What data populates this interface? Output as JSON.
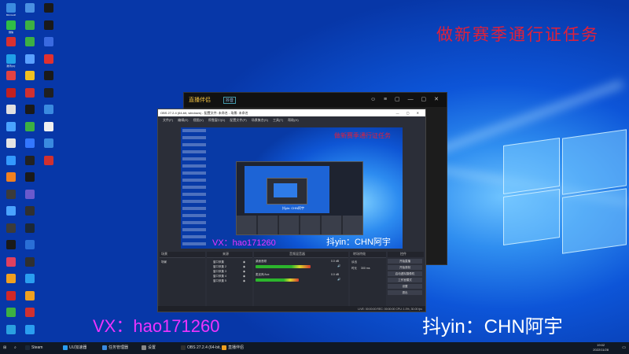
{
  "watermark": {
    "top_right": "做新赛季通行证任务",
    "bottom_left": "VX：hao171260",
    "bottom_right": "抖yin：CHN阿宇"
  },
  "desktop_icons": [
    {
      "label": "Microsoft",
      "color": "#3b8be0"
    },
    {
      "label": "微信",
      "color": "#2fbd46"
    },
    {
      "label": "",
      "color": "#d93030"
    },
    {
      "label": "腾讯QQ",
      "color": "#20a0e8"
    },
    {
      "label": "",
      "color": "#e24242"
    },
    {
      "label": "",
      "color": "#c22020"
    },
    {
      "label": "",
      "color": "#e0e0e0"
    },
    {
      "label": "",
      "color": "#4aa3ff"
    },
    {
      "label": "",
      "color": "#e4e4e4"
    },
    {
      "label": "",
      "color": "#3399ff"
    },
    {
      "label": "",
      "color": "#f08020"
    },
    {
      "label": "",
      "color": "#3b3b3b"
    },
    {
      "label": "",
      "color": "#4aa3ff"
    },
    {
      "label": "",
      "color": "#3b3b3b"
    },
    {
      "label": "",
      "color": "#1a1a1a"
    },
    {
      "label": "",
      "color": "#e04060"
    },
    {
      "label": "",
      "color": "#f0a020"
    },
    {
      "label": "",
      "color": "#d02828"
    },
    {
      "label": "",
      "color": "#3cb043"
    },
    {
      "label": "",
      "color": "#2aa0e0"
    },
    {
      "label": "",
      "color": "#4a90e2"
    },
    {
      "label": "",
      "color": "#3cb043"
    },
    {
      "label": "",
      "color": "#3cb043"
    },
    {
      "label": "",
      "color": "#5aa0ff"
    },
    {
      "label": "",
      "color": "#f0c020"
    },
    {
      "label": "",
      "color": "#d03030"
    },
    {
      "label": "",
      "color": "#1a1a1a"
    },
    {
      "label": "",
      "color": "#3cb043"
    },
    {
      "label": "",
      "color": "#3377ff"
    },
    {
      "label": "",
      "color": "#222222"
    },
    {
      "label": "",
      "color": "#1a1a1a"
    },
    {
      "label": "",
      "color": "#6a5acd"
    },
    {
      "label": "",
      "color": "#303030"
    },
    {
      "label": "",
      "color": "#1b2838"
    },
    {
      "label": "",
      "color": "#2a6fd6"
    },
    {
      "label": "",
      "color": "#303030"
    },
    {
      "label": "",
      "color": "#2a9ef0"
    },
    {
      "label": "",
      "color": "#f0a020"
    },
    {
      "label": "",
      "color": "#d03030"
    },
    {
      "label": "",
      "color": "#2a9ef0"
    },
    {
      "label": "",
      "color": "#1a1a1a"
    },
    {
      "label": "",
      "color": "#1a1a1a"
    },
    {
      "label": "",
      "color": "#3a6ae0"
    },
    {
      "label": "",
      "color": "#e03030"
    },
    {
      "label": "",
      "color": "#1a1a1a"
    },
    {
      "label": "",
      "color": "#202020"
    },
    {
      "label": "",
      "color": "#3a8ae0"
    },
    {
      "label": "",
      "color": "#f0f0f0"
    },
    {
      "label": "",
      "color": "#3a8ae0"
    },
    {
      "label": "",
      "color": "#d03030"
    }
  ],
  "bg_app": {
    "logo": "直播伴侣",
    "tag": "抖音",
    "controls": "☺ ≡ ▢ — ▢ ✕"
  },
  "obs": {
    "title": "OBS 27.2.4 (64-bit, windows) - 配置文件: 未命名 - 场景: 未命名",
    "window_controls": "— ▢ ✕",
    "menu": [
      "文件(F)",
      "编辑(E)",
      "视图(V)",
      "停靠窗口(D)",
      "配置文件(P)",
      "场景集合(S)",
      "工具(T)",
      "帮助(H)"
    ],
    "preview_watermark": "做新赛季通行证任务",
    "preview_vx": "VX：hao171260",
    "preview_dy": "抖yin：CHN阿宇",
    "nested_text": "抖yin: CHN阿宇",
    "panels": {
      "scenes": "场景",
      "sources": "来源",
      "mixer": "音频混音器",
      "transitions": "转场特效",
      "controls": "控件"
    },
    "scene_items": [
      "场景"
    ],
    "source_items": [
      "窗口采集",
      "窗口采集 2",
      "窗口采集 3",
      "窗口采集 4",
      "窗口采集 5"
    ],
    "mixer_tracks": [
      {
        "name": "桌面音频",
        "db": "0.0 dB",
        "level": 0.7
      },
      {
        "name": "麦克风/Aux",
        "db": "0.0 dB",
        "level": 0.55
      }
    ],
    "transition": {
      "type": "淡出",
      "duration_label": "时长",
      "duration": "300 ms"
    },
    "control_buttons": [
      "开始直播",
      "开始录制",
      "启动虚拟摄像机",
      "工作室模式",
      "设置",
      "退出"
    ],
    "status": "LIVE: 00:00:00   REC: 00:00:00   CPU: 1.0%, 30.00 fps"
  },
  "taskbar": {
    "items": [
      {
        "label": "Steam",
        "color": "#1b2838"
      },
      {
        "label": "UU加速器",
        "color": "#2a9ef0"
      },
      {
        "label": "任务管理器",
        "color": "#3a8ae0"
      },
      {
        "label": "设置",
        "color": "#888888"
      },
      {
        "label": "OBS 27.2.4 (64-bit,",
        "color": "#303030"
      },
      {
        "label": "直播伴侣",
        "color": "#f0a020"
      }
    ],
    "time": "19:02",
    "date": "2022/11/28"
  }
}
